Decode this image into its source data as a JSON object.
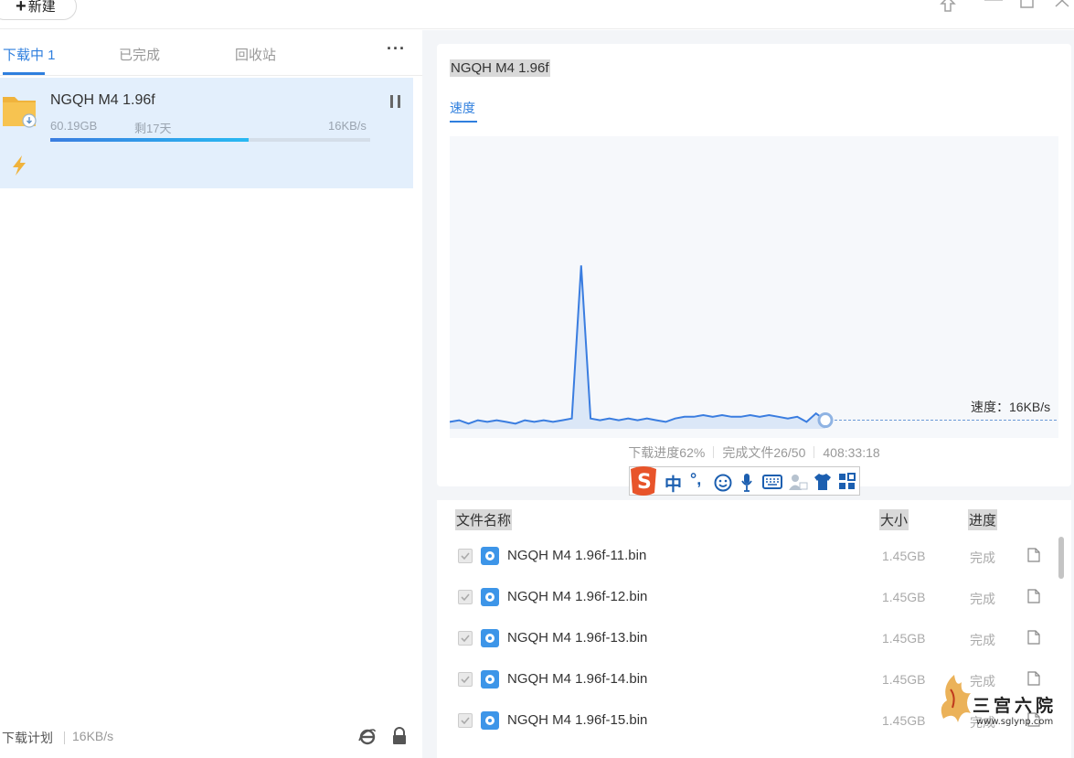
{
  "toolbar": {
    "new_label": "新建"
  },
  "tabs": [
    {
      "label": "下载中 1",
      "active": true
    },
    {
      "label": "已完成",
      "active": false
    },
    {
      "label": "回收站",
      "active": false
    }
  ],
  "task": {
    "name": "NGQH M4 1.96f",
    "size": "60.19GB",
    "remaining": "剩17天",
    "speed": "16KB/s",
    "progress": 0.62
  },
  "footer": {
    "plan_label": "下载计划",
    "speed": "16KB/s"
  },
  "detail": {
    "title": "NGQH M4 1.96f",
    "speed_tab": "速度",
    "current_speed": "速度：16KB/s",
    "stat_progress": "下载进度62%",
    "stat_files": "完成文件26/50",
    "stat_time": "408:33:18"
  },
  "chart_data": {
    "type": "line",
    "title": "",
    "xlabel": "",
    "ylabel": "",
    "series": [
      {
        "values": [
          3,
          4,
          2,
          4,
          3,
          4,
          3,
          2,
          4,
          3,
          4,
          3,
          4,
          5,
          95,
          5,
          4,
          5,
          4,
          5,
          4,
          5,
          4,
          3,
          5,
          6,
          6,
          7,
          6,
          7,
          6,
          6,
          7,
          6,
          7,
          6,
          5,
          6,
          3,
          8,
          4
        ]
      }
    ]
  },
  "file_table": {
    "headers": {
      "name": "文件名称",
      "size": "大小",
      "progress": "进度"
    },
    "rows": [
      {
        "name": "NGQH M4 1.96f-11.bin",
        "size": "1.45GB",
        "status": "完成"
      },
      {
        "name": "NGQH M4 1.96f-12.bin",
        "size": "1.45GB",
        "status": "完成"
      },
      {
        "name": "NGQH M4 1.96f-13.bin",
        "size": "1.45GB",
        "status": "完成"
      },
      {
        "name": "NGQH M4 1.96f-14.bin",
        "size": "1.45GB",
        "status": "完成"
      },
      {
        "name": "NGQH M4 1.96f-15.bin",
        "size": "1.45GB",
        "status": "完成"
      }
    ]
  },
  "ime": {
    "mode": "中",
    "punct": "°,"
  },
  "watermark": {
    "text": "三宫六院",
    "url": "www.sglynp.com"
  },
  "colors": {
    "accent": "#2f7fde",
    "selected_bg": "#e3effc",
    "chart_line": "#3a7de0"
  }
}
